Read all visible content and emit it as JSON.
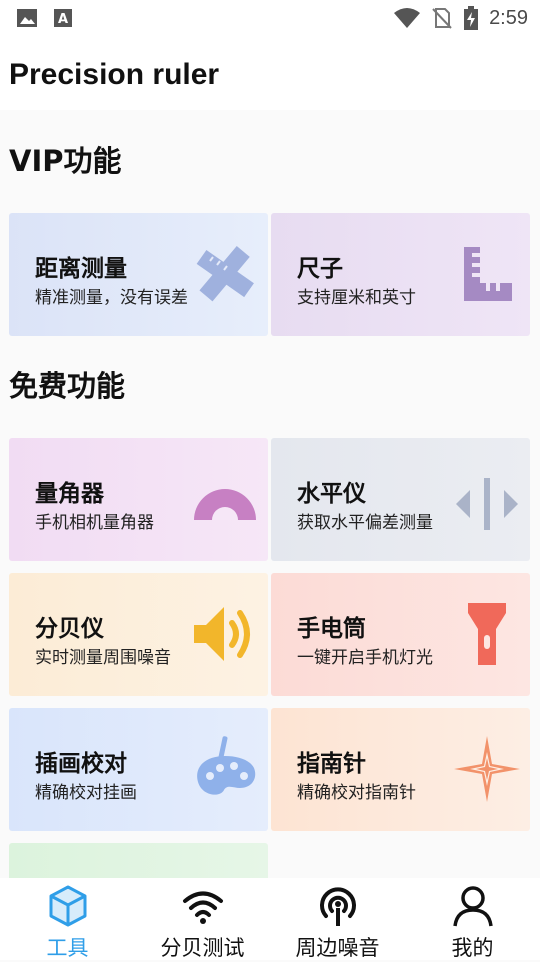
{
  "status_bar": {
    "time": "2:59",
    "icons": [
      "image-icon",
      "text-a-icon",
      "wifi-icon",
      "no-sim-icon",
      "battery-charging-icon"
    ]
  },
  "header": {
    "title": "Precision ruler"
  },
  "sections": {
    "vip": {
      "title": "VIP功能"
    },
    "free": {
      "title": "免费功能"
    }
  },
  "cards": [
    {
      "title": "距离测量",
      "subtitle": "精准测量，没有误差",
      "icon": "ruler-cross-icon",
      "color": "#9fb1de"
    },
    {
      "title": "尺子",
      "subtitle": "支持厘米和英寸",
      "icon": "square-ruler-icon",
      "color": "#a58ac3"
    },
    {
      "title": "量角器",
      "subtitle": "手机相机量角器",
      "icon": "protractor-icon",
      "color": "#c780c3"
    },
    {
      "title": "水平仪",
      "subtitle": "获取水平偏差测量",
      "icon": "level-icon",
      "color": "#aab3c8"
    },
    {
      "title": "分贝仪",
      "subtitle": "实时测量周围噪音",
      "icon": "speaker-icon",
      "color": "#f2b62b"
    },
    {
      "title": "手电筒",
      "subtitle": "一键开启手机灯光",
      "icon": "flashlight-icon",
      "color": "#f0695a"
    },
    {
      "title": "插画校对",
      "subtitle": "精确校对挂画",
      "icon": "palette-icon",
      "color": "#8fb1ea"
    },
    {
      "title": "指南针",
      "subtitle": "精确校对指南针",
      "icon": "compass-star-icon",
      "color": "#f2926a"
    }
  ],
  "bottom_nav": [
    {
      "label": "工具",
      "icon": "cube-icon",
      "active": true
    },
    {
      "label": "分贝测试",
      "icon": "wifi-signal-icon",
      "active": false
    },
    {
      "label": "周边噪音",
      "icon": "broadcast-icon",
      "active": false
    },
    {
      "label": "我的",
      "icon": "person-icon",
      "active": false
    }
  ],
  "colors": {
    "accent": "#2f9ee8",
    "text": "#111111",
    "background": "#fafafa"
  }
}
